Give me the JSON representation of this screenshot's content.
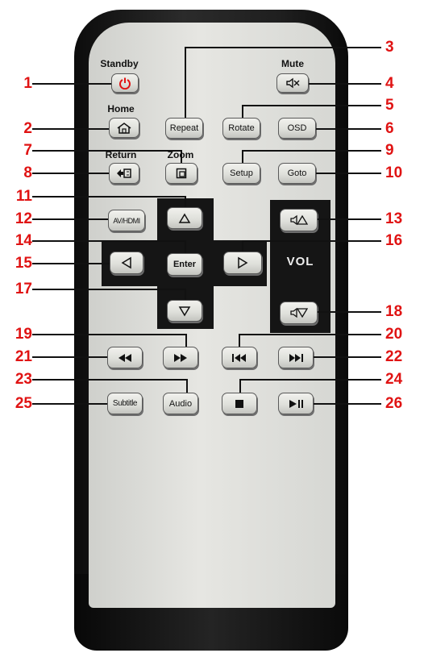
{
  "labels": {
    "standby": "Standby",
    "mute": "Mute",
    "home": "Home",
    "return": "Return",
    "zoom": "Zoom",
    "vol": "VOL"
  },
  "buttons": {
    "repeat": "Repeat",
    "rotate": "Rotate",
    "osd": "OSD",
    "setup": "Setup",
    "goto": "Goto",
    "avhdmi": "AV/HDMI",
    "enter": "Enter",
    "subtitle": "Subtitle",
    "audio": "Audio"
  },
  "callouts": [
    "1",
    "2",
    "3",
    "4",
    "5",
    "6",
    "7",
    "8",
    "9",
    "10",
    "11",
    "12",
    "13",
    "14",
    "15",
    "16",
    "17",
    "18",
    "19",
    "20",
    "21",
    "22",
    "23",
    "24",
    "25",
    "26"
  ],
  "colors": {
    "callout": "#e01313",
    "power_icon": "#e01313",
    "leader": "#111111"
  }
}
